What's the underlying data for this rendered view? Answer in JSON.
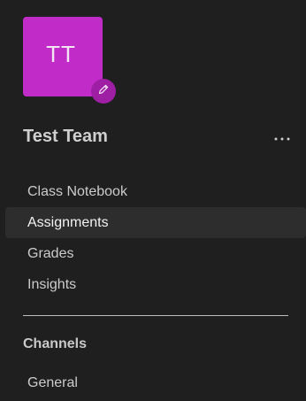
{
  "team": {
    "initials": "TT",
    "name": "Test Team",
    "avatar_color": "#c12bc7",
    "edit_icon": "pencil-icon",
    "more_icon": "more-horizontal-icon"
  },
  "nav": {
    "items": [
      {
        "label": "Class Notebook",
        "selected": false
      },
      {
        "label": "Assignments",
        "selected": true
      },
      {
        "label": "Grades",
        "selected": false
      },
      {
        "label": "Insights",
        "selected": false
      }
    ]
  },
  "channels": {
    "heading": "Channels",
    "items": [
      {
        "label": "General"
      }
    ]
  }
}
